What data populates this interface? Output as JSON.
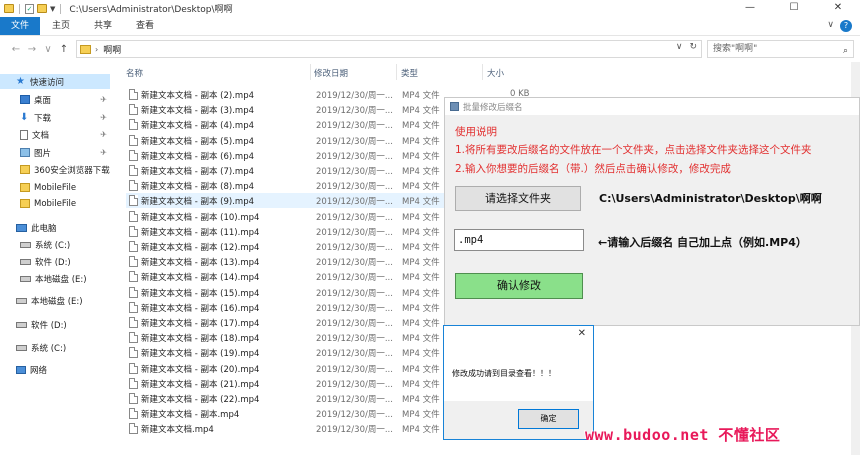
{
  "window": {
    "title_path": "C:\\Users\\Administrator\\Desktop\\啊啊",
    "minimize": "—",
    "maximize": "☐",
    "close": "✕"
  },
  "ribbon": {
    "tabs": [
      "文件",
      "主页",
      "共享",
      "查看"
    ],
    "expand": "∨"
  },
  "address": {
    "back": "←",
    "forward": "→",
    "recent": "∨",
    "up": "↑",
    "sep": "›",
    "folder": "啊啊",
    "dropdown": "∨",
    "refresh": "↻",
    "search_placeholder": "搜索\"啊啊\"",
    "search_icon": "⌕"
  },
  "sidebar": {
    "items": [
      {
        "label": "快速访问",
        "icon": "star-icon"
      },
      {
        "label": "桌面",
        "icon": "desktop-icon",
        "pinned": true
      },
      {
        "label": "下载",
        "icon": "download-icon",
        "pinned": true
      },
      {
        "label": "文档",
        "icon": "document-icon",
        "pinned": true
      },
      {
        "label": "图片",
        "icon": "picture-icon",
        "pinned": true
      },
      {
        "label": "360安全浏览器下载",
        "icon": "folder-icon"
      },
      {
        "label": "MobileFile",
        "icon": "folder-icon"
      },
      {
        "label": "MobileFile",
        "icon": "folder-icon"
      },
      {
        "label": "此电脑",
        "icon": "pc-icon"
      },
      {
        "label": "系统 (C:)",
        "icon": "drive-icon"
      },
      {
        "label": "软件 (D:)",
        "icon": "drive-icon"
      },
      {
        "label": "本地磁盘 (E:)",
        "icon": "drive-icon"
      },
      {
        "label": "本地磁盘 (E:)",
        "icon": "drive-icon"
      },
      {
        "label": "软件 (D:)",
        "icon": "drive-icon"
      },
      {
        "label": "系统 (C:)",
        "icon": "drive-icon"
      },
      {
        "label": "网络",
        "icon": "network-icon"
      }
    ],
    "pin_glyph": "📌"
  },
  "filelist": {
    "columns": [
      "名称",
      "修改日期",
      "类型",
      "大小"
    ],
    "rows": [
      {
        "name": "新建文本文档 - 副本 (2).mp4",
        "date": "2019/12/30/周一...",
        "type": "MP4 文件",
        "size": "0 KB"
      },
      {
        "name": "新建文本文档 - 副本 (3).mp4",
        "date": "2019/12/30/周一...",
        "type": "MP4 文件",
        "size": ""
      },
      {
        "name": "新建文本文档 - 副本 (4).mp4",
        "date": "2019/12/30/周一...",
        "type": "MP4 文件",
        "size": ""
      },
      {
        "name": "新建文本文档 - 副本 (5).mp4",
        "date": "2019/12/30/周一...",
        "type": "MP4 文件",
        "size": ""
      },
      {
        "name": "新建文本文档 - 副本 (6).mp4",
        "date": "2019/12/30/周一...",
        "type": "MP4 文件",
        "size": ""
      },
      {
        "name": "新建文本文档 - 副本 (7).mp4",
        "date": "2019/12/30/周一...",
        "type": "MP4 文件",
        "size": ""
      },
      {
        "name": "新建文本文档 - 副本 (8).mp4",
        "date": "2019/12/30/周一...",
        "type": "MP4 文件",
        "size": ""
      },
      {
        "name": "新建文本文档 - 副本 (9).mp4",
        "date": "2019/12/30/周一...",
        "type": "MP4 文件",
        "size": ""
      },
      {
        "name": "新建文本文档 - 副本 (10).mp4",
        "date": "2019/12/30/周一...",
        "type": "MP4 文件",
        "size": ""
      },
      {
        "name": "新建文本文档 - 副本 (11).mp4",
        "date": "2019/12/30/周一...",
        "type": "MP4 文件",
        "size": ""
      },
      {
        "name": "新建文本文档 - 副本 (12).mp4",
        "date": "2019/12/30/周一...",
        "type": "MP4 文件",
        "size": ""
      },
      {
        "name": "新建文本文档 - 副本 (13).mp4",
        "date": "2019/12/30/周一...",
        "type": "MP4 文件",
        "size": ""
      },
      {
        "name": "新建文本文档 - 副本 (14).mp4",
        "date": "2019/12/30/周一...",
        "type": "MP4 文件",
        "size": ""
      },
      {
        "name": "新建文本文档 - 副本 (15).mp4",
        "date": "2019/12/30/周一...",
        "type": "MP4 文件",
        "size": ""
      },
      {
        "name": "新建文本文档 - 副本 (16).mp4",
        "date": "2019/12/30/周一...",
        "type": "MP4 文件",
        "size": ""
      },
      {
        "name": "新建文本文档 - 副本 (17).mp4",
        "date": "2019/12/30/周一...",
        "type": "MP4 文件",
        "size": ""
      },
      {
        "name": "新建文本文档 - 副本 (18).mp4",
        "date": "2019/12/30/周一...",
        "type": "MP4 文件",
        "size": ""
      },
      {
        "name": "新建文本文档 - 副本 (19).mp4",
        "date": "2019/12/30/周一...",
        "type": "MP4 文件",
        "size": ""
      },
      {
        "name": "新建文本文档 - 副本 (20).mp4",
        "date": "2019/12/30/周一...",
        "type": "MP4 文件",
        "size": ""
      },
      {
        "name": "新建文本文档 - 副本 (21).mp4",
        "date": "2019/12/30/周一...",
        "type": "MP4 文件",
        "size": ""
      },
      {
        "name": "新建文本文档 - 副本 (22).mp4",
        "date": "2019/12/30/周一...",
        "type": "MP4 文件",
        "size": ""
      },
      {
        "name": "新建文本文档 - 副本.mp4",
        "date": "2019/12/30/周一...",
        "type": "MP4 文件",
        "size": ""
      },
      {
        "name": "新建文本文档.mp4",
        "date": "2019/12/30/周一...",
        "type": "MP4 文件",
        "size": ""
      }
    ],
    "selected_index": 7
  },
  "app": {
    "title": "批量修改后缀名",
    "instructions": [
      "使用说明",
      "1.将所有要改后缀名的文件放在一个文件夹，点击选择文件夹选择这个文件夹",
      "2.输入你想要的后缀名（带.）然后点击确认修改，修改完成"
    ],
    "choose_button": "请选择文件夹",
    "chosen_path": "C:\\Users\\Administrator\\Desktop\\啊啊",
    "suffix_value": ".mp4",
    "suffix_hint": "←请输入后缀名 自己加上点（例如.MP4）",
    "confirm_button": "确认修改"
  },
  "dialog": {
    "close": "✕",
    "message": "修改成功请到目录查看！！！",
    "ok_button": "确定"
  },
  "watermark": "www.budoo.net 不懂社区",
  "colors": {
    "accent": "#1979ca",
    "instruction_red": "#e23030",
    "confirm_green": "#8ae08a",
    "watermark": "#e8195a"
  }
}
